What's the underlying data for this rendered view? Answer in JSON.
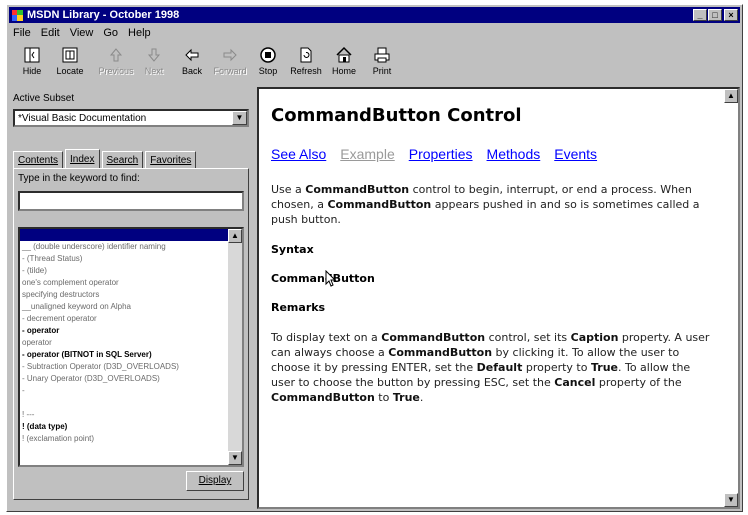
{
  "window": {
    "title": "MSDN Library - October 1998",
    "min": "_",
    "max": "□",
    "close": "×"
  },
  "menu": [
    "File",
    "Edit",
    "View",
    "Go",
    "Help"
  ],
  "toolbar": [
    {
      "label": "Hide",
      "icon": "hide-icon",
      "enabled": true
    },
    {
      "label": "Locate",
      "icon": "locate-icon",
      "enabled": true
    },
    {
      "label": "Previous",
      "icon": "up-arrow-icon",
      "enabled": false
    },
    {
      "label": "Next",
      "icon": "down-arrow-icon",
      "enabled": false
    },
    {
      "label": "Back",
      "icon": "back-arrow-icon",
      "enabled": true
    },
    {
      "label": "Forward",
      "icon": "forward-arrow-icon",
      "enabled": false
    },
    {
      "label": "Stop",
      "icon": "stop-icon",
      "enabled": true
    },
    {
      "label": "Refresh",
      "icon": "refresh-icon",
      "enabled": true
    },
    {
      "label": "Home",
      "icon": "home-icon",
      "enabled": true
    },
    {
      "label": "Print",
      "icon": "print-icon",
      "enabled": true
    }
  ],
  "left": {
    "active_subset_label": "Active Subset",
    "active_subset_value": "*Visual Basic Documentation",
    "tabs": [
      "Contents",
      "Index",
      "Search",
      "Favorites"
    ],
    "active_tab": "Index",
    "keyword_prompt": "Type in the keyword to find:",
    "keyword_value": "",
    "index_items": [
      {
        "text": "",
        "style": "selected"
      },
      {
        "text": "__ (double underscore) identifier naming",
        "style": "normal"
      },
      {
        "text": "- (Thread Status)",
        "style": "normal"
      },
      {
        "text": "- (tilde)",
        "style": "normal"
      },
      {
        "text": "one's complement operator",
        "style": "normal"
      },
      {
        "text": "specifying destructors",
        "style": "normal"
      },
      {
        "text": "__unaligned keyword on Alpha",
        "style": "normal"
      },
      {
        "text": "- decrement operator",
        "style": "normal"
      },
      {
        "text": "- operator",
        "style": "bold"
      },
      {
        "text": "operator",
        "style": "normal"
      },
      {
        "text": "- operator (BITNOT in SQL Server)",
        "style": "bold"
      },
      {
        "text": "- Subtraction Operator (D3D_OVERLOADS)",
        "style": "normal"
      },
      {
        "text": "- Unary Operator (D3D_OVERLOADS)",
        "style": "normal"
      },
      {
        "text": "-",
        "style": "normal"
      },
      {
        "text": "",
        "style": "normal"
      },
      {
        "text": "! ---",
        "style": "normal"
      },
      {
        "text": "! (data type)",
        "style": "bold"
      },
      {
        "text": "! (exclamation point)",
        "style": "normal"
      }
    ],
    "display_button": "Display"
  },
  "topic": {
    "title": "CommandButton Control",
    "links": [
      {
        "text": "See Also",
        "enabled": true
      },
      {
        "text": "Example",
        "enabled": false
      },
      {
        "text": "Properties",
        "enabled": true
      },
      {
        "text": "Methods",
        "enabled": true
      },
      {
        "text": "Events",
        "enabled": true
      }
    ],
    "intro_1": "Use a ",
    "intro_b1": "CommandButton",
    "intro_2": " control to begin, interrupt, or end a process. When chosen, a ",
    "intro_b2": "CommandButton",
    "intro_3": " appears pushed in and so is sometimes called a push button.",
    "syntax_heading": "Syntax",
    "syntax_value": "CommandButton",
    "remarks_heading": "Remarks",
    "remarks": [
      {
        "t": "To display text on a ",
        "b": false
      },
      {
        "t": "CommandButton",
        "b": true
      },
      {
        "t": " control, set its ",
        "b": false
      },
      {
        "t": "Caption",
        "b": true
      },
      {
        "t": " property. A user can always choose a ",
        "b": false
      },
      {
        "t": "CommandButton",
        "b": true
      },
      {
        "t": " by clicking it. To allow the user to choose it by pressing ENTER, set the ",
        "b": false
      },
      {
        "t": "Default",
        "b": true
      },
      {
        "t": " property to ",
        "b": false
      },
      {
        "t": "True",
        "b": true
      },
      {
        "t": ". To allow the user to choose the button by pressing ESC, set the ",
        "b": false
      },
      {
        "t": "Cancel",
        "b": true
      },
      {
        "t": " property of the ",
        "b": false
      },
      {
        "t": "CommandButton",
        "b": true
      },
      {
        "t": " to ",
        "b": false
      },
      {
        "t": "True",
        "b": true
      },
      {
        "t": ".",
        "b": false
      }
    ]
  }
}
